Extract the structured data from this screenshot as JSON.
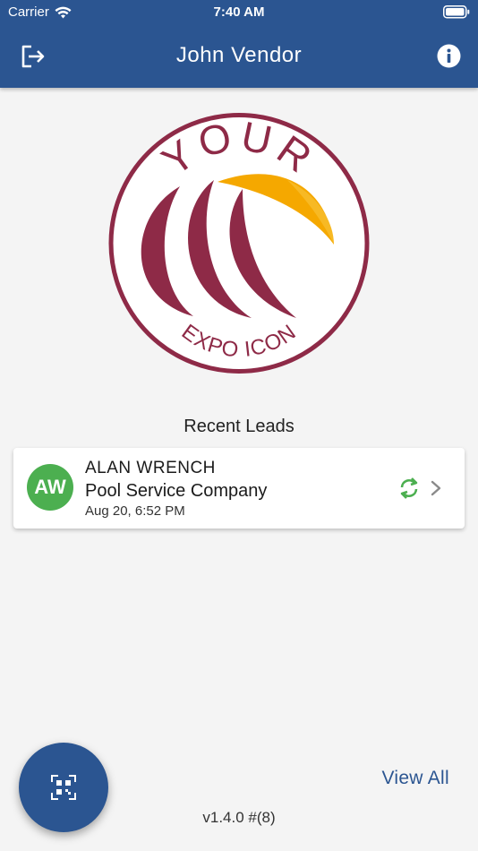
{
  "status_bar": {
    "carrier": "Carrier",
    "time": "7:40 AM"
  },
  "header": {
    "title": "John Vendor",
    "left_icon": "logout-icon",
    "right_icon": "info-icon"
  },
  "logo": {
    "top_text": "YOUR",
    "bottom_text": "EXPO ICON",
    "colors": {
      "ring": "#8e2a47",
      "accent": "#f5a800"
    }
  },
  "recent_leads": {
    "title": "Recent Leads",
    "items": [
      {
        "initials": "AW",
        "name": "ALAN WRENCH",
        "company": "Pool Service Company",
        "date": "Aug 20, 6:52 PM",
        "status_icon": "sync-icon"
      }
    ]
  },
  "footer": {
    "view_all_label": "View All",
    "version": "v1.4.0 #(8)",
    "fab_icon": "qr-scan-icon"
  },
  "colors": {
    "primary": "#2b5591",
    "avatar": "#4caf50",
    "sync": "#4caf50",
    "background": "#f4f4f4"
  }
}
